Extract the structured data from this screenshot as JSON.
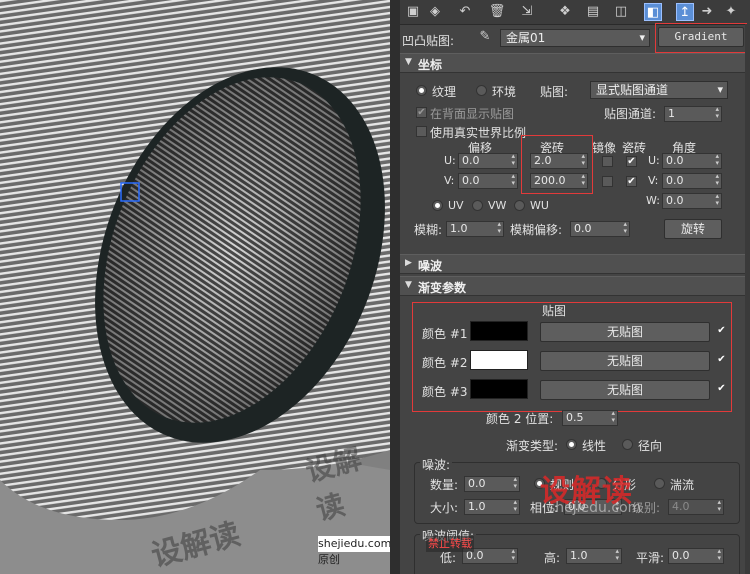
{
  "toolbar": {
    "icons": [
      "assign-material-icon",
      "put-to-scene-icon",
      "reset-icon",
      "delete-icon",
      "make-unique-icon",
      "put-to-library-icon",
      "material-effects-icon",
      "show-map-icon",
      "show-background-icon",
      "go-to-parent-icon",
      "go-forward-icon"
    ]
  },
  "header": {
    "bump_label": "凹凸贴图:",
    "map_name": "金属01",
    "map_type_button": "Gradient"
  },
  "coordinates": {
    "title": "坐标",
    "texture_label": "纹理",
    "environ_label": "环境",
    "mapping_label": "贴图:",
    "mapping_value": "显式贴图通道",
    "show_back_label": "在背面显示贴图",
    "map_channel_label": "贴图通道:",
    "map_channel_value": "1",
    "real_world_label": "使用真实世界比例",
    "offset_header": "偏移",
    "tiling_header": "瓷砖",
    "mirror_header": "镜像",
    "tile_header": "瓷砖",
    "angle_header": "角度",
    "u_label": "U:",
    "v_label": "V:",
    "w_label": "W:",
    "offset_u": "0.0",
    "offset_v": "0.0",
    "tiling_u": "2.0",
    "tiling_v": "200.0",
    "angle_u": "0.0",
    "angle_v": "0.0",
    "angle_w": "0.0",
    "uv_label": "UV",
    "vw_label": "VW",
    "wu_label": "WU",
    "blur_label": "模糊:",
    "blur_value": "1.0",
    "blur_offset_label": "模糊偏移:",
    "blur_offset_value": "0.0",
    "rotate_button": "旋转"
  },
  "noise_rollout": {
    "title": "噪波"
  },
  "gradient": {
    "title": "渐变参数",
    "maps_header": "贴图",
    "color1_label": "颜色 #1",
    "color2_label": "颜色 #2",
    "color3_label": "颜色 #3",
    "color1": "#000000",
    "color2": "#ffffff",
    "color3": "#000000",
    "no_map": "无贴图",
    "color2_pos_label": "颜色 2 位置:",
    "color2_pos_value": "0.5",
    "type_label": "渐变类型:",
    "linear_label": "线性",
    "radial_label": "径向"
  },
  "noise": {
    "group_label": "噪波:",
    "amount_label": "数量:",
    "amount_value": "0.0",
    "regular_label": "规则",
    "fractal_label": "分形",
    "turbulence_label": "湍流",
    "size_label": "大小:",
    "size_value": "1.0",
    "phase_label": "相位:",
    "phase_value": "0.0",
    "levels_label": "级别:",
    "levels_value": "4.0",
    "threshold_label": "噪波阈值:",
    "low_label": "低:",
    "low_value": "0.0",
    "high_label": "高:",
    "high_value": "1.0",
    "smooth_label": "平滑:",
    "smooth_value": "0.0"
  },
  "watermark": {
    "site_left": "shejiedu.com原创",
    "no_repost": "禁止转载",
    "brand": "设解读",
    "brand_url": "shejiedu.com",
    "bg_brand": "设解读"
  }
}
